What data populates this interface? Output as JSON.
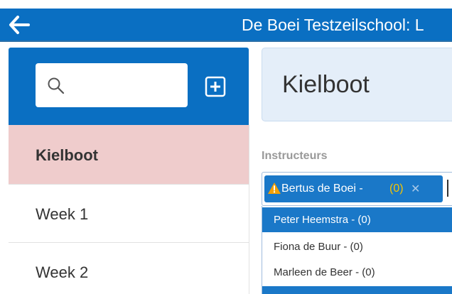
{
  "app": {
    "title": "De Boei Testzeilschool: L"
  },
  "sidebar": {
    "search": {
      "placeholder": "",
      "value": ""
    },
    "items": [
      {
        "label": "Kielboot",
        "active": true
      },
      {
        "label": "Week 1",
        "active": false
      },
      {
        "label": "Week 2",
        "active": false
      }
    ]
  },
  "main": {
    "title": "Kielboot",
    "instructors": {
      "label": "Instructeurs",
      "selected": [
        {
          "name": "Bertus de Boei -",
          "count": "(0)",
          "warning": true
        }
      ],
      "options": [
        {
          "label": "Peter Heemstra - (0)",
          "highlighted": true
        },
        {
          "label": "Fiona de Buur - (0)",
          "highlighted": false
        },
        {
          "label": "Marleen de Beer - (0)",
          "highlighted": false
        }
      ]
    }
  },
  "icons": {
    "back": "back-arrow-icon",
    "search": "search-icon",
    "add": "add-square-icon",
    "warning": "warning-icon",
    "remove": "close-icon"
  },
  "colors": {
    "primary": "#0a6fc2",
    "active_item": "#efcccc",
    "header_panel": "#e4eef9",
    "tag": "#1a78c8",
    "warning": "#f5a000",
    "count": "#f5c400"
  }
}
